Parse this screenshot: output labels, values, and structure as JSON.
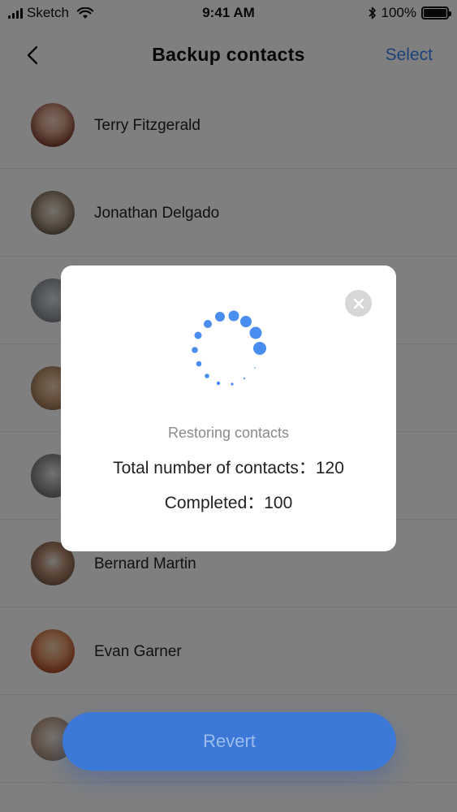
{
  "status_bar": {
    "carrier": "Sketch",
    "time": "9:41 AM",
    "battery_percent": "100%"
  },
  "nav": {
    "title": "Backup contacts",
    "select_label": "Select"
  },
  "contacts": [
    {
      "name": "Terry Fitzgerald"
    },
    {
      "name": "Jonathan Delgado"
    },
    {
      "name": ""
    },
    {
      "name": ""
    },
    {
      "name": ""
    },
    {
      "name": "Bernard Martin"
    },
    {
      "name": "Evan Garner"
    },
    {
      "name": ""
    }
  ],
  "modal": {
    "status_text": "Restoring contacts",
    "total_text": "Total number of contacts：120",
    "completed_text": "Completed：100",
    "total_contacts": 120,
    "completed_contacts": 100
  },
  "revert_label": "Revert",
  "colors": {
    "accent": "#3b82f6",
    "button": "#3b78d8",
    "overlay": "rgba(0,0,0,0.5)"
  }
}
